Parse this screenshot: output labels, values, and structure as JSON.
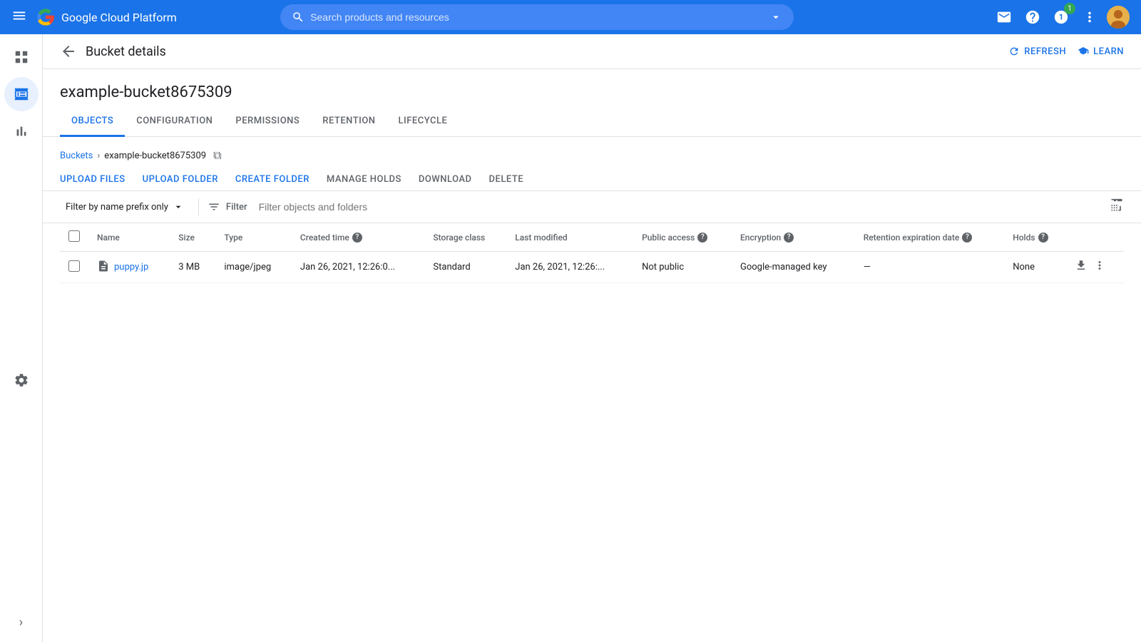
{
  "topbar": {
    "menu_icon": "☰",
    "logo_text": "Google Cloud Platform",
    "search_placeholder": "Search products and resources",
    "search_dropdown_icon": "▾",
    "notification_count": "1",
    "icons": {
      "email": "✉",
      "help": "?",
      "dots": "⋮"
    }
  },
  "sidebar": {
    "items": [
      {
        "id": "grid",
        "label": "grid-icon"
      },
      {
        "id": "storage",
        "label": "storage-icon",
        "active": true
      },
      {
        "id": "analytics",
        "label": "analytics-icon"
      },
      {
        "id": "settings",
        "label": "settings-icon"
      }
    ],
    "expand_label": "›"
  },
  "page_header": {
    "back_label": "←",
    "title": "Bucket details",
    "refresh_label": "REFRESH",
    "learn_label": "LEARN"
  },
  "bucket": {
    "name": "example-bucket8675309"
  },
  "tabs": [
    {
      "id": "objects",
      "label": "OBJECTS",
      "active": true
    },
    {
      "id": "configuration",
      "label": "CONFIGURATION"
    },
    {
      "id": "permissions",
      "label": "PERMISSIONS"
    },
    {
      "id": "retention",
      "label": "RETENTION"
    },
    {
      "id": "lifecycle",
      "label": "LIFECYCLE"
    }
  ],
  "breadcrumb": {
    "buckets_label": "Buckets",
    "separator": "›",
    "current": "example-bucket8675309"
  },
  "toolbar": {
    "upload_files": "UPLOAD FILES",
    "upload_folder": "UPLOAD FOLDER",
    "create_folder": "CREATE FOLDER",
    "manage_holds": "MANAGE HOLDS",
    "download": "DOWNLOAD",
    "delete": "DELETE"
  },
  "filter": {
    "prefix_label": "Filter by name prefix only",
    "filter_label": "Filter",
    "filter_placeholder": "Filter objects and folders"
  },
  "table": {
    "columns": [
      {
        "id": "name",
        "label": "Name",
        "help": false
      },
      {
        "id": "size",
        "label": "Size",
        "help": false
      },
      {
        "id": "type",
        "label": "Type",
        "help": false
      },
      {
        "id": "created_time",
        "label": "Created time",
        "help": true
      },
      {
        "id": "storage_class",
        "label": "Storage class",
        "help": false
      },
      {
        "id": "last_modified",
        "label": "Last modified",
        "help": false
      },
      {
        "id": "public_access",
        "label": "Public access",
        "help": true
      },
      {
        "id": "encryption",
        "label": "Encryption",
        "help": true
      },
      {
        "id": "retention_expiration",
        "label": "Retention expiration date",
        "help": true
      },
      {
        "id": "holds",
        "label": "Holds",
        "help": true
      }
    ],
    "rows": [
      {
        "name": "puppy.jp",
        "size": "3 MB",
        "type": "image/jpeg",
        "created_time": "Jan 26, 2021, 12:26:0...",
        "storage_class": "Standard",
        "last_modified": "Jan 26, 2021, 12:26:...",
        "public_access": "Not public",
        "encryption": "Google-managed key",
        "retention_expiration": "—",
        "holds": "None"
      }
    ]
  }
}
